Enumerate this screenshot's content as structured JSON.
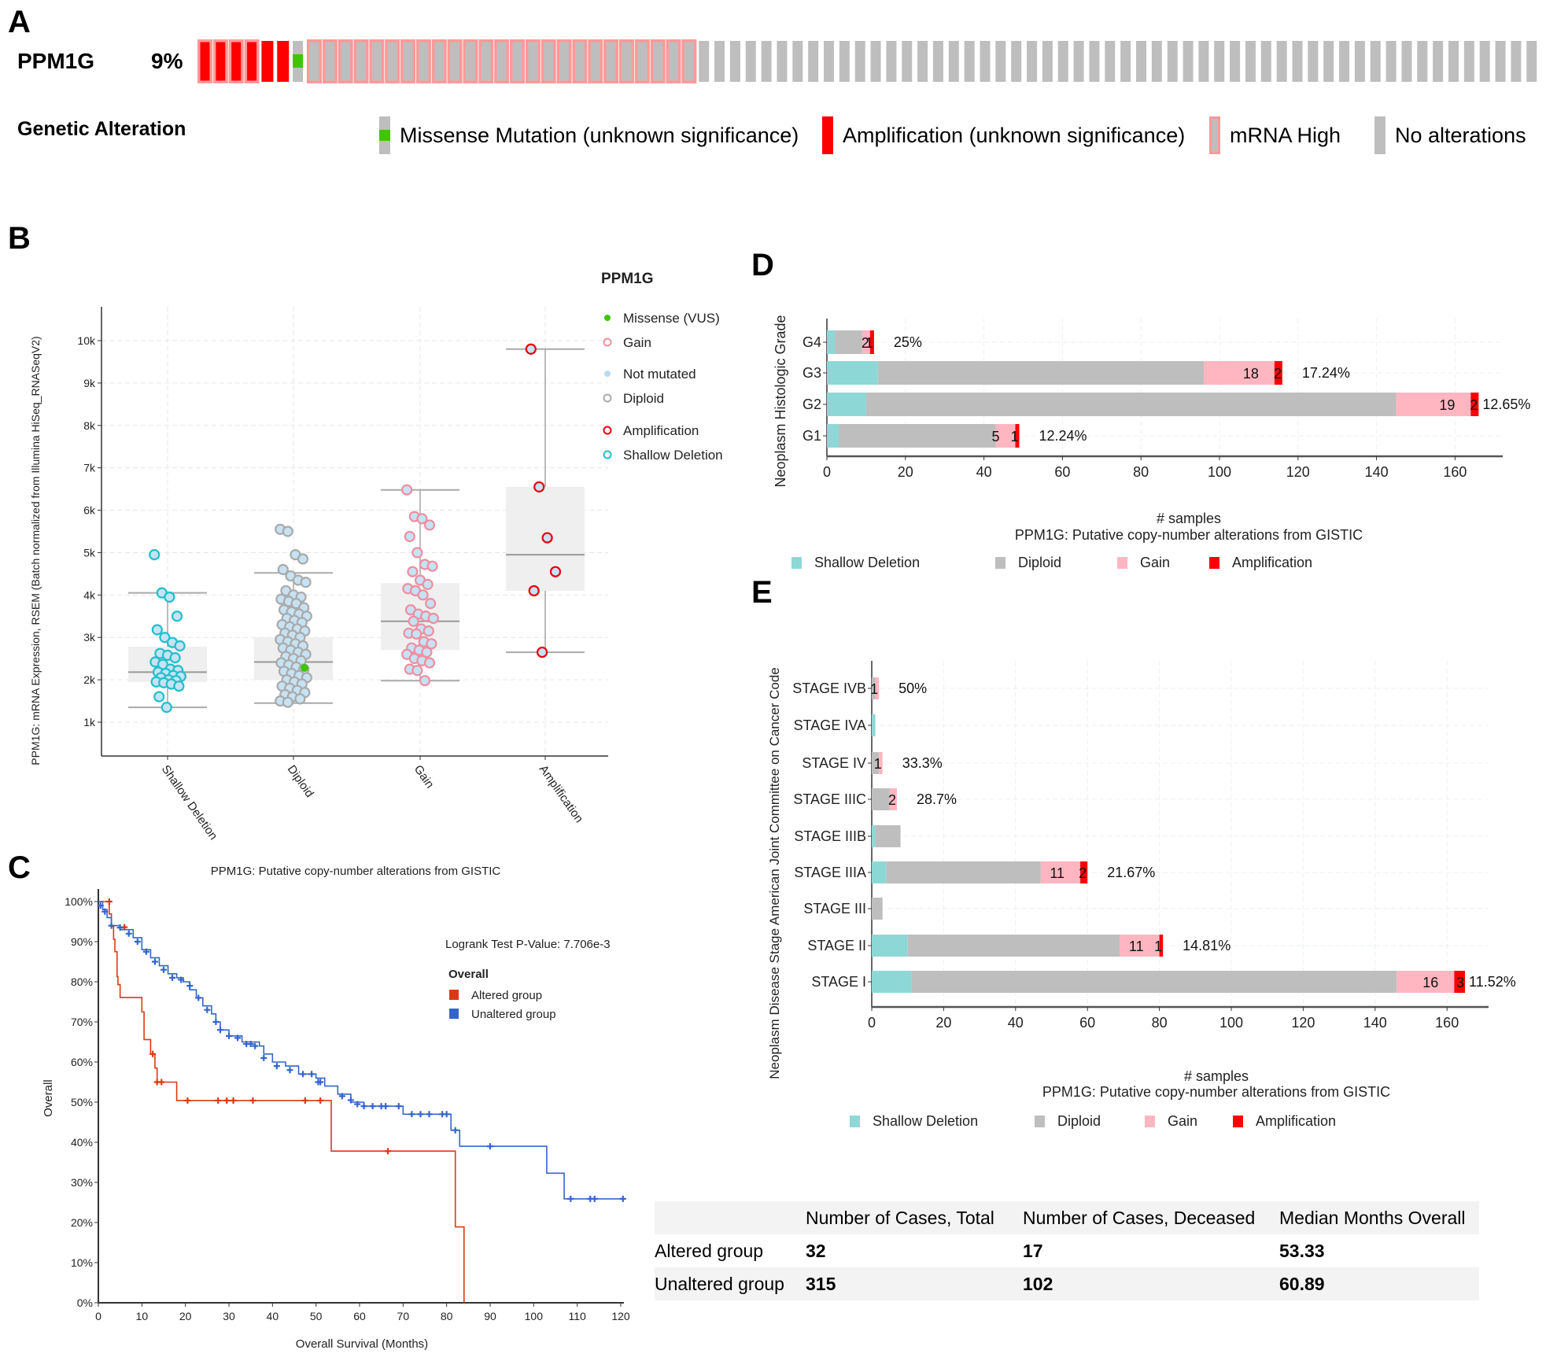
{
  "panels": {
    "a": "A",
    "b": "B",
    "c": "C",
    "d": "D",
    "e": "E"
  },
  "oncoprint": {
    "gene": "PPM1G",
    "percent_altered": "9%",
    "legend_title": "Genetic Alteration",
    "samples": {
      "amplification_and_mrna_high": 4,
      "amplification": 2,
      "missense": 1,
      "mrna_high": 25,
      "no_alteration": 54
    },
    "legend": [
      {
        "key": "missense",
        "label": "Missense Mutation (unknown significance)",
        "color": "#3ec600"
      },
      {
        "key": "amplification",
        "label": "Amplification (unknown significance)",
        "color": "#ff0000"
      },
      {
        "key": "mrna_high",
        "label": "mRNA High",
        "color": "#ff9999"
      },
      {
        "key": "none",
        "label": "No alterations",
        "color": "#bebebe"
      }
    ]
  },
  "chart_data": [
    {
      "id": "B",
      "type": "box-scatter",
      "ylabel": "PPM1G: mRNA Expression, RSEM (Batch normalized from Illumina HiSeq_RNASeqV2)",
      "categories": [
        "Shallow Deletion",
        "Diploid",
        "Gain",
        "Amplification"
      ],
      "y_ticks": [
        "1k",
        "2k",
        "3k",
        "4k",
        "5k",
        "6k",
        "7k",
        "8k",
        "9k",
        "10k"
      ],
      "ylim": [
        0,
        10900
      ],
      "grid": true,
      "legend_title": "PPM1G",
      "legend": [
        {
          "label": "Missense (VUS)",
          "style": "dot",
          "color": "#3ec600"
        },
        {
          "label": "Gain",
          "style": "ring",
          "color": "#f08ea0"
        },
        {
          "label": "Not mutated",
          "style": "dot",
          "color": "#b8dcf0"
        },
        {
          "label": "Diploid",
          "style": "ring",
          "color": "#aaaaaa"
        },
        {
          "label": "Amplification",
          "style": "ring",
          "color": "#e8000b"
        },
        {
          "label": "Shallow Deletion",
          "style": "ring",
          "color": "#1fc0cc"
        }
      ],
      "boxes": [
        {
          "category": "Shallow Deletion",
          "min": 1350,
          "q1": 1950,
          "median": 2180,
          "q3": 2780,
          "max": 4050,
          "color": "#1fc0cc",
          "points": [
            4950,
            4050,
            3950,
            3500,
            3180,
            3000,
            2880,
            2800,
            2620,
            2580,
            2520,
            2420,
            2360,
            2250,
            2220,
            2180,
            2150,
            2100,
            2080,
            2050,
            2000,
            1980,
            1950,
            1930,
            1900,
            1850,
            1600,
            1350
          ]
        },
        {
          "category": "Diploid",
          "min": 1450,
          "q1": 2000,
          "median": 2420,
          "q3": 3000,
          "max": 4520,
          "color": "#aaaaaa",
          "points": [
            5550,
            5500,
            4950,
            4850,
            4600,
            4450,
            4350,
            4300,
            4100,
            4000,
            3950,
            3900,
            3850,
            3800,
            3700,
            3650,
            3600,
            3550,
            3500,
            3450,
            3400,
            3350,
            3300,
            3250,
            3200,
            3150,
            3100,
            3050,
            3000,
            2950,
            2900,
            2850,
            2800,
            2750,
            2700,
            2650,
            2600,
            2550,
            2500,
            2450,
            2400,
            2350,
            2300,
            2250,
            2200,
            2150,
            2100,
            2050,
            2000,
            1950,
            1900,
            1850,
            1800,
            1750,
            1700,
            1650,
            1600,
            1550,
            1500,
            1470
          ],
          "missense_point": 2280
        },
        {
          "category": "Gain",
          "min": 1980,
          "q1": 2700,
          "median": 3380,
          "q3": 4280,
          "max": 6480,
          "color": "#f08ea0",
          "points": [
            6480,
            5850,
            5800,
            5650,
            5380,
            5000,
            4720,
            4680,
            4550,
            4350,
            4250,
            4150,
            4100,
            4000,
            3800,
            3650,
            3550,
            3500,
            3450,
            3380,
            3200,
            3150,
            3100,
            3080,
            2900,
            2850,
            2750,
            2700,
            2650,
            2600,
            2500,
            2450,
            2400,
            2250,
            2220,
            1980
          ]
        },
        {
          "category": "Amplification",
          "min": 2650,
          "q1": 4100,
          "median": 4950,
          "q3": 6550,
          "max": 9800,
          "color": "#e8000b",
          "points": [
            9800,
            6550,
            5350,
            4550,
            4100,
            2650
          ]
        }
      ]
    },
    {
      "id": "C",
      "type": "line",
      "title": "PPM1G: Putative copy-number alterations from GISTIC",
      "xlabel": "Overall Survival (Months)",
      "ylabel": "Overall",
      "x_ticks": [
        0,
        10,
        20,
        30,
        40,
        50,
        60,
        70,
        80,
        90,
        100,
        110,
        120
      ],
      "y_ticks": [
        "0%",
        "10%",
        "20%",
        "30%",
        "40%",
        "50%",
        "60%",
        "70%",
        "80%",
        "90%",
        "100%"
      ],
      "xlim": [
        0,
        121
      ],
      "ylim": [
        0,
        100
      ],
      "pvalue_text": "Logrank Test P-Value: 7.706e-3",
      "legend_title": "Overall",
      "legend": [
        {
          "label": "Altered group",
          "color": "#dc3912"
        },
        {
          "label": "Unaltered group",
          "color": "#3366cc"
        }
      ],
      "series": [
        {
          "name": "Altered group",
          "color": "#dc3912",
          "steps": [
            [
              0,
              100
            ],
            [
              2.5,
              96.9
            ],
            [
              3,
              93.8
            ],
            [
              3.5,
              90.6
            ],
            [
              3.8,
              87.5
            ],
            [
              4.3,
              81.3
            ],
            [
              4.5,
              79.3
            ],
            [
              5,
              76.1
            ],
            [
              10,
              72.5
            ],
            [
              10.5,
              65.6
            ],
            [
              12,
              62
            ],
            [
              13,
              58.5
            ],
            [
              13.5,
              55
            ],
            [
              18,
              50.4
            ],
            [
              53.5,
              37.8
            ],
            [
              82,
              18.9
            ],
            [
              84,
              0
            ]
          ],
          "censors": [
            [
              2.5,
              100
            ],
            [
              6,
              93.6
            ],
            [
              12.5,
              62
            ],
            [
              13.5,
              55
            ],
            [
              14.5,
              55
            ],
            [
              20.5,
              50.4
            ],
            [
              27.5,
              50.4
            ],
            [
              29.5,
              50.4
            ],
            [
              31,
              50.4
            ],
            [
              35.5,
              50.4
            ],
            [
              47.5,
              50.4
            ],
            [
              51,
              50.4
            ],
            [
              66.5,
              37.8
            ]
          ]
        },
        {
          "name": "Unaltered group",
          "color": "#3366cc",
          "steps": [
            [
              0,
              100
            ],
            [
              1,
              98
            ],
            [
              2,
              96
            ],
            [
              3,
              94
            ],
            [
              5,
              93
            ],
            [
              8,
              91
            ],
            [
              10,
              88
            ],
            [
              12,
              86
            ],
            [
              14,
              84
            ],
            [
              16,
              82
            ],
            [
              18,
              81
            ],
            [
              19.5,
              80
            ],
            [
              21,
              78
            ],
            [
              22.5,
              76
            ],
            [
              24,
              74
            ],
            [
              26,
              72
            ],
            [
              27,
              70
            ],
            [
              28,
              68
            ],
            [
              30,
              66.5
            ],
            [
              33,
              65
            ],
            [
              37,
              64
            ],
            [
              38,
              62
            ],
            [
              40,
              60
            ],
            [
              43,
              59
            ],
            [
              46,
              57
            ],
            [
              50,
              56
            ],
            [
              52,
              54
            ],
            [
              55,
              52
            ],
            [
              58,
              50
            ],
            [
              61,
              49
            ],
            [
              70,
              47
            ],
            [
              81,
              43
            ],
            [
              83,
              39
            ],
            [
              103,
              32.3
            ],
            [
              107,
              25.9
            ],
            [
              121,
              25.9
            ]
          ],
          "censors": [
            [
              0.5,
              99
            ],
            [
              1.5,
              97.5
            ],
            [
              3,
              94
            ],
            [
              5,
              93.5
            ],
            [
              7,
              92
            ],
            [
              9,
              90
            ],
            [
              11,
              87.5
            ],
            [
              13,
              85
            ],
            [
              15,
              83
            ],
            [
              17,
              81
            ],
            [
              19,
              80.5
            ],
            [
              21,
              79
            ],
            [
              23,
              76
            ],
            [
              25,
              73
            ],
            [
              27,
              70
            ],
            [
              28,
              68
            ],
            [
              30,
              66.5
            ],
            [
              32,
              66
            ],
            [
              34,
              64.5
            ],
            [
              35,
              64.5
            ],
            [
              36,
              64
            ],
            [
              38,
              61
            ],
            [
              41,
              59
            ],
            [
              44,
              58
            ],
            [
              47,
              57
            ],
            [
              49,
              57
            ],
            [
              50.5,
              55
            ],
            [
              51,
              55
            ],
            [
              56,
              51.5
            ],
            [
              58,
              50.5
            ],
            [
              59.5,
              49.5
            ],
            [
              61,
              49
            ],
            [
              63,
              49
            ],
            [
              65,
              49
            ],
            [
              66,
              49
            ],
            [
              69,
              49
            ],
            [
              72,
              47
            ],
            [
              74,
              47
            ],
            [
              76,
              47
            ],
            [
              79,
              47
            ],
            [
              80,
              47
            ],
            [
              82,
              43
            ],
            [
              90,
              39
            ],
            [
              108.5,
              25.9
            ],
            [
              113,
              25.9
            ],
            [
              114,
              25.9
            ],
            [
              120.5,
              25.9
            ]
          ]
        }
      ]
    },
    {
      "id": "D",
      "type": "bar",
      "orientation": "horizontal-stacked",
      "ylabel": "Neoplasm Histologic Grade",
      "xlabel": "# samples",
      "subtitle": "PPM1G: Putative copy-number alterations from GISTIC",
      "x_ticks": [
        0,
        20,
        40,
        60,
        80,
        100,
        120,
        140,
        160
      ],
      "xlim": [
        0,
        172
      ],
      "legend": [
        {
          "label": "Shallow Deletion",
          "color": "#8dd8d6"
        },
        {
          "label": "Diploid",
          "color": "#bebebe"
        },
        {
          "label": "Gain",
          "color": "#ffb6c1"
        },
        {
          "label": "Amplification",
          "color": "#ff0000"
        }
      ],
      "categories": [
        "G4",
        "G3",
        "G2",
        "G1"
      ],
      "series": [
        {
          "name": "Shallow Deletion",
          "values": [
            2,
            13,
            10,
            3
          ]
        },
        {
          "name": "Diploid",
          "values": [
            7,
            83,
            135,
            40
          ]
        },
        {
          "name": "Gain",
          "values": [
            2,
            18,
            19,
            5
          ]
        },
        {
          "name": "Amplification",
          "values": [
            1,
            2,
            2,
            1
          ]
        }
      ],
      "percent_labels": [
        "25%",
        "17.24%",
        "12.65%",
        "12.24%"
      ]
    },
    {
      "id": "E",
      "type": "bar",
      "orientation": "horizontal-stacked",
      "ylabel": "Neoplasm Disease Stage American Joint Committee on Cancer Code",
      "xlabel": "# samples",
      "subtitle": "PPM1G: Putative copy-number alterations from GISTIC",
      "x_ticks": [
        0,
        20,
        40,
        60,
        80,
        100,
        120,
        140,
        160
      ],
      "xlim": [
        0,
        171
      ],
      "legend": [
        {
          "label": "Shallow Deletion",
          "color": "#8dd8d6"
        },
        {
          "label": "Diploid",
          "color": "#bebebe"
        },
        {
          "label": "Gain",
          "color": "#ffb6c1"
        },
        {
          "label": "Amplification",
          "color": "#ff0000"
        }
      ],
      "categories": [
        "STAGE IVB",
        "STAGE IVA",
        "STAGE IV",
        "STAGE IIIC",
        "STAGE IIIB",
        "STAGE IIIA",
        "STAGE III",
        "STAGE II",
        "STAGE I"
      ],
      "series": [
        {
          "name": "Shallow Deletion",
          "values": [
            0,
            1,
            0,
            0,
            1,
            4,
            0,
            10,
            11
          ]
        },
        {
          "name": "Diploid",
          "values": [
            1,
            0,
            2,
            5,
            7,
            43,
            3,
            59,
            135
          ]
        },
        {
          "name": "Gain",
          "values": [
            1,
            0,
            1,
            2,
            0,
            11,
            0,
            11,
            16
          ]
        },
        {
          "name": "Amplification",
          "values": [
            0,
            0,
            0,
            0,
            0,
            2,
            0,
            1,
            3
          ]
        }
      ],
      "percent_labels": [
        "50%",
        "",
        "33.3%",
        "28.7%",
        "",
        "21.67%",
        "",
        "14.81%",
        "11.52%"
      ]
    }
  ],
  "survival_table": {
    "headers": [
      "",
      "Number of Cases, Total",
      "Number of Cases, Deceased",
      "Median Months Overall"
    ],
    "rows": [
      {
        "group": "Altered group",
        "total": "32",
        "deceased": "17",
        "median": "53.33"
      },
      {
        "group": "Unaltered group",
        "total": "315",
        "deceased": "102",
        "median": "60.89"
      }
    ]
  }
}
